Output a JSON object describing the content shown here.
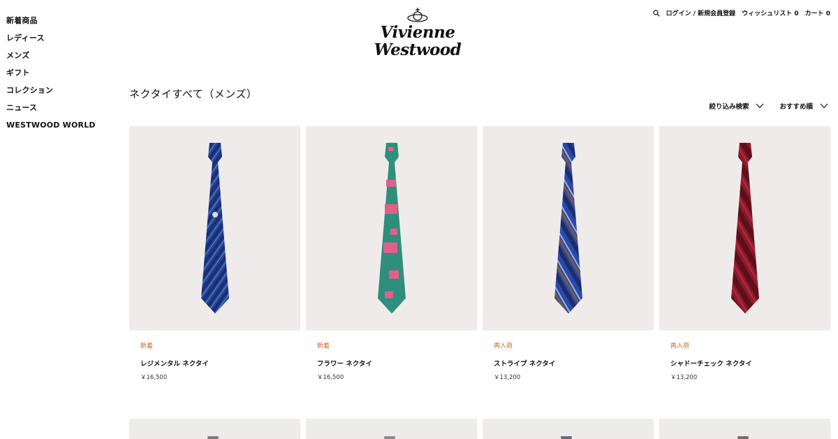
{
  "nav": {
    "items": [
      {
        "label": "新着商品"
      },
      {
        "label": "レディース"
      },
      {
        "label": "メンズ"
      },
      {
        "label": "ギフト"
      },
      {
        "label": "コレクション"
      },
      {
        "label": "ニュース"
      },
      {
        "label": "WESTWOOD WORLD"
      }
    ]
  },
  "logo": {
    "line1": "Vivienne",
    "line2": "Westwood"
  },
  "utility": {
    "search_icon": "search-icon",
    "login": "ログイン / 新規会員登録",
    "wishlist": "ウィッシュリスト 0",
    "cart": "カート 0"
  },
  "page": {
    "title": "ネクタイすべて（メンズ）"
  },
  "controls": {
    "filter": "絞り込み検索",
    "sort": "おすすめ順"
  },
  "products": [
    {
      "badge": "新着",
      "name": "レジメンタル ネクタイ",
      "price": "￥16,500",
      "tie_colors": [
        "#2a3f9e",
        "#1d2b78",
        "#3cb08c"
      ]
    },
    {
      "badge": "新着",
      "name": "フラワー ネクタイ",
      "price": "￥16,500",
      "tie_colors": [
        "#2e8f7c",
        "#247565",
        "#e0608a"
      ]
    },
    {
      "badge": "再入荷",
      "name": "ストライプ ネクタイ",
      "price": "￥13,200",
      "tie_colors": [
        "#2b4aa8",
        "#1b2d6b",
        "#7c5a3a"
      ]
    },
    {
      "badge": "再入荷",
      "name": "シャドーチェック ネクタイ",
      "price": "￥13,200",
      "tie_colors": [
        "#8a1a2a",
        "#5e0f1c",
        "#a8283a"
      ]
    }
  ],
  "colors": {
    "accent_badge": "#c06a2f",
    "image_bg": "#efebeb"
  }
}
